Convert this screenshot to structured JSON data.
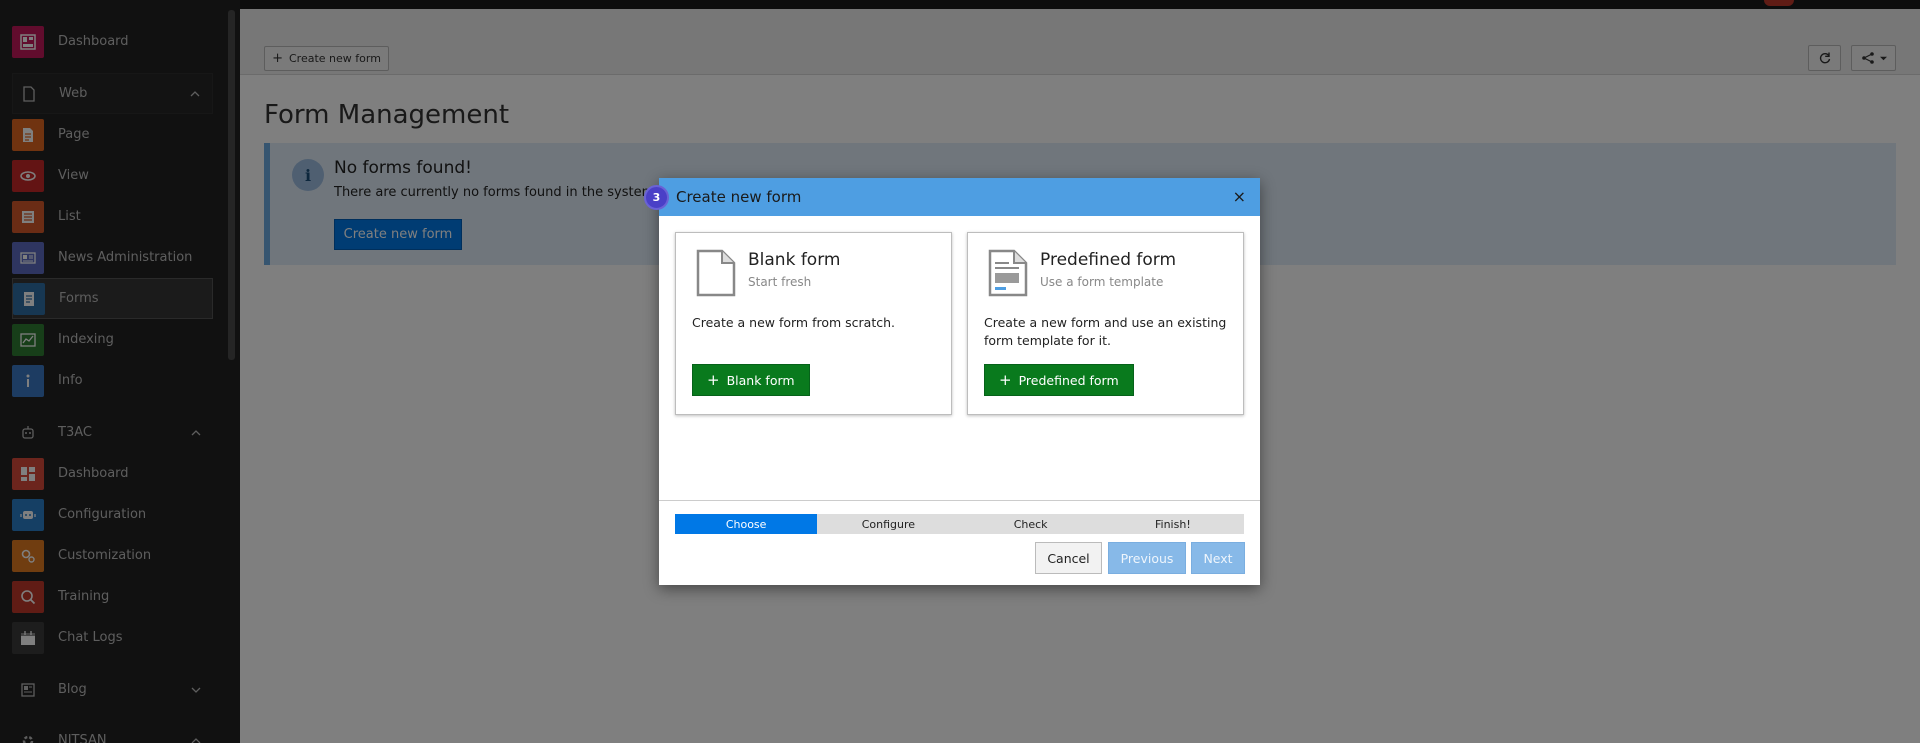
{
  "sidebar": {
    "items": [
      {
        "label": "Dashboard",
        "icon": "dashboard-icon",
        "color": "#c2185b"
      },
      {
        "label": "Web",
        "icon": "page-tree-icon",
        "color": ""
      },
      {
        "label": "Page",
        "icon": "page-icon",
        "color": "#e06620"
      },
      {
        "label": "View",
        "icon": "eye-icon",
        "color": "#c62828"
      },
      {
        "label": "List",
        "icon": "list-icon",
        "color": "#d4582a"
      },
      {
        "label": "News Administration",
        "icon": "news-icon",
        "color": "#5c6bc0"
      },
      {
        "label": "Forms",
        "icon": "form-icon",
        "color": "#2f6ea5"
      },
      {
        "label": "Indexing",
        "icon": "chart-icon",
        "color": "#2e7d32"
      },
      {
        "label": "Info",
        "icon": "info-icon",
        "color": "#3b78c4"
      },
      {
        "label": "T3AC",
        "icon": "robot-icon",
        "color": ""
      },
      {
        "label": "Dashboard",
        "icon": "dashboard-grid-icon",
        "color": "#d84a3a"
      },
      {
        "label": "Configuration",
        "icon": "robot-config-icon",
        "color": "#2a7fc9"
      },
      {
        "label": "Customization",
        "icon": "gears-icon",
        "color": "#e07a20"
      },
      {
        "label": "Training",
        "icon": "training-icon",
        "color": "#c0392b"
      },
      {
        "label": "Chat Logs",
        "icon": "calendar-log-icon",
        "color": "#3a3a3a"
      },
      {
        "label": "Blog",
        "icon": "blog-icon",
        "color": ""
      },
      {
        "label": "NITSAN",
        "icon": "gear-icon",
        "color": ""
      }
    ]
  },
  "docheader": {
    "create_label": "Create new form",
    "reload_icon": "reload-icon",
    "share_icon": "share-icon"
  },
  "main": {
    "title": "Form Management",
    "info": {
      "title": "No forms found!",
      "text": "There are currently no forms found in the system.",
      "button": "Create new form"
    }
  },
  "modal": {
    "title": "Create new form",
    "step_marker": "3",
    "close": "×",
    "cards": [
      {
        "title": "Blank form",
        "subtitle": "Start fresh",
        "desc": "Create a new form from scratch.",
        "button": "Blank form"
      },
      {
        "title": "Predefined form",
        "subtitle": "Use a form template",
        "desc": "Create a new form and use an existing form template for it.",
        "button": "Predefined form"
      }
    ],
    "steps": [
      "Choose",
      "Configure",
      "Check",
      "Finish!"
    ],
    "active_step": "Choose",
    "buttons": {
      "cancel": "Cancel",
      "previous": "Previous",
      "next": "Next"
    }
  },
  "colors": {
    "modal_header": "#4e9ee2",
    "primary": "#0078e6",
    "success": "#097a1d"
  }
}
